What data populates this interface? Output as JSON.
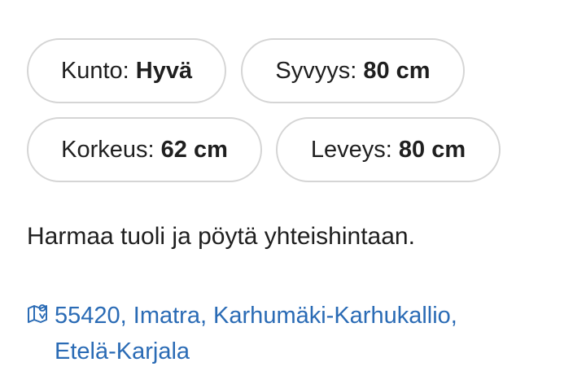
{
  "details": {
    "condition": {
      "label": "Kunto:",
      "value": "Hyvä"
    },
    "depth": {
      "label": "Syvyys:",
      "value": "80 cm"
    },
    "height": {
      "label": "Korkeus:",
      "value": "62 cm"
    },
    "width": {
      "label": "Leveys:",
      "value": "80 cm"
    }
  },
  "description": "Harmaa tuoli ja pöytä yhteishintaan.",
  "location": {
    "icon": "map-icon",
    "line1": "55420, Imatra, Karhumäki-Karhukallio,",
    "line2": "Etelä-Karjala",
    "color": "#2a6bb5"
  }
}
